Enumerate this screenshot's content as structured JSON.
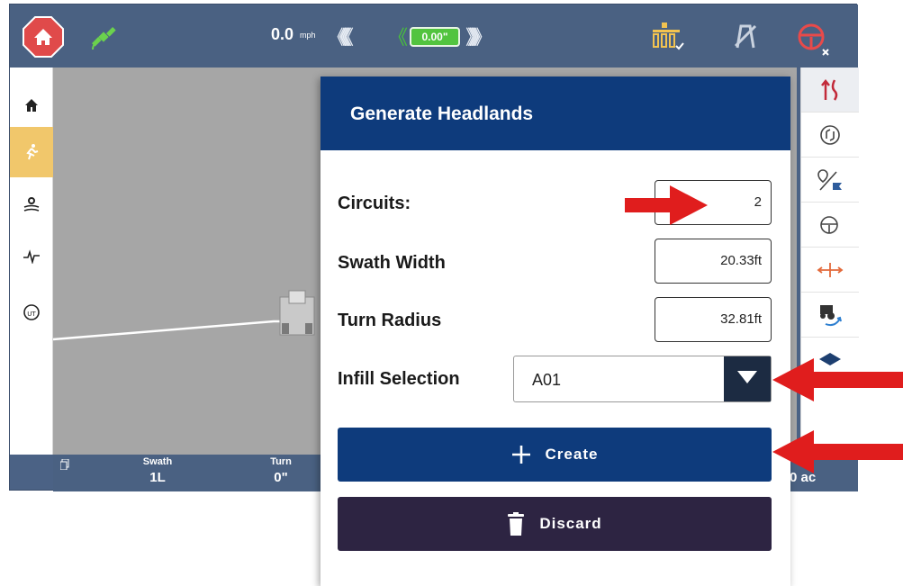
{
  "topbar": {
    "speed_value": "0.0",
    "speed_unit": "mph",
    "chevrons_left": "《《《《《",
    "chevron_left_green": "《",
    "offset_value": "0.00\"",
    "chevrons_right": "》》》》》"
  },
  "bottombar": {
    "swath_label": "Swath",
    "swath_value": "1L",
    "turn_label": "Turn",
    "turn_value": "0\"",
    "area_value": "0 ac"
  },
  "dialog": {
    "title": "Generate Headlands",
    "circuits_label": "Circuits:",
    "circuits_value": "2",
    "swath_width_label": "Swath Width",
    "swath_width_value": "20.33ft",
    "turn_radius_label": "Turn Radius",
    "turn_radius_value": "32.81ft",
    "infill_label": "Infill Selection",
    "infill_value": "A01",
    "create_label": "Create",
    "discard_label": "Discard"
  },
  "colors": {
    "header_blue": "#0e3b7c",
    "discard_purple": "#2d2442",
    "status_bar": "#4a6182",
    "annotation_red": "#e01d1d",
    "active_tab": "#f1c76b",
    "offset_green": "#52c43f"
  },
  "icons": {
    "topbar": [
      "home-icon",
      "satellite-icon",
      "implement-icon",
      "guidance-off-icon",
      "steering-disabled-icon"
    ],
    "leftbar": [
      "home-icon",
      "guidance-run-icon",
      "field-settings-icon",
      "diagnostics-icon",
      "ut-icon"
    ],
    "rightbar": [
      "path-icon",
      "rotate-icon",
      "location-flag-icon",
      "steering-icon",
      "alignment-icon",
      "tractor-swap-icon",
      "layers-icon"
    ]
  }
}
